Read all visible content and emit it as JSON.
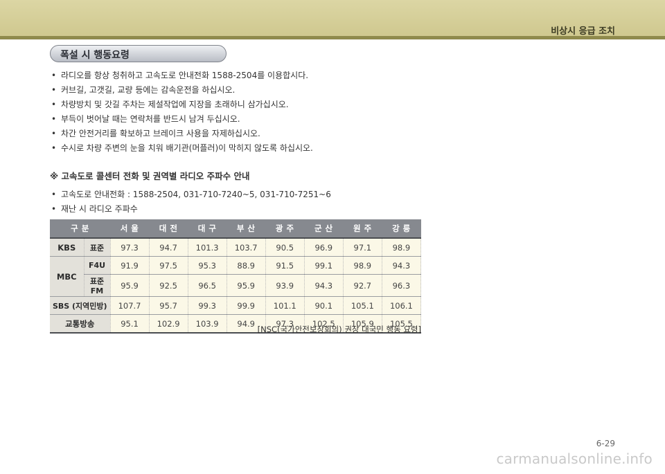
{
  "header": {
    "title": "비상시 응급 조치"
  },
  "section1": {
    "title": "폭설 시 행동요령",
    "bullets": [
      "라디오를 항상 청취하고 고속도로 안내전화 1588-2504를 이용합시다.",
      "커브길, 고갯길, 교량 등에는 감속운전을 하십시오.",
      "차량방치 및 갓길 주차는 제설작업에 지장을 초래하니 삼가십시오.",
      "부득이 벗어날 때는 연락처를 반드시 남겨 두십시오.",
      "차간 안전거리를 확보하고 브레이크 사용을 자제하십시오.",
      "수시로 차량 주변의 눈을 치워 배기관(머플러)이 막히지 않도록 하십시오."
    ]
  },
  "section2": {
    "title": "※  고속도로 콜센터 전화 및 권역별 라디오 주파수 안내",
    "bullets": [
      "고속도로 안내전화 : 1588-2504, 031-710-7240~5, 031-710-7251~6",
      "재난 시 라디오 주파수"
    ]
  },
  "table": {
    "header": [
      "구  분",
      "서 울",
      "대 전",
      "대 구",
      "부 산",
      "광 주",
      "군 산",
      "원 주",
      "강 릉"
    ],
    "rows": {
      "kbs": {
        "label": "KBS",
        "sub": "표준",
        "values": [
          "97.3",
          "94.7",
          "101.3",
          "103.7",
          "90.5",
          "96.9",
          "97.1",
          "98.9"
        ]
      },
      "mbc_f4u": {
        "label": "MBC",
        "sub": "F4U",
        "values": [
          "91.9",
          "97.5",
          "95.3",
          "88.9",
          "91.5",
          "99.1",
          "98.9",
          "94.3"
        ]
      },
      "mbc_fm": {
        "sub": "표준FM",
        "values": [
          "95.9",
          "92.5",
          "96.5",
          "95.9",
          "93.9",
          "94.3",
          "92.7",
          "96.3"
        ]
      },
      "sbs": {
        "label": "SBS (지역민방)",
        "values": [
          "107.7",
          "95.7",
          "99.3",
          "99.9",
          "101.1",
          "90.1",
          "105.1",
          "106.1"
        ]
      },
      "traffic": {
        "label": "교통방송",
        "values": [
          "95.1",
          "102.9",
          "103.9",
          "94.9",
          "97.3",
          "102.5",
          "105.9",
          "105.5"
        ]
      }
    },
    "source": "[NSC(국가안전보장회의) 권장 대국민 행동 요령]"
  },
  "footer": {
    "page": "6-29",
    "watermark": "carmanualsonline.info"
  }
}
